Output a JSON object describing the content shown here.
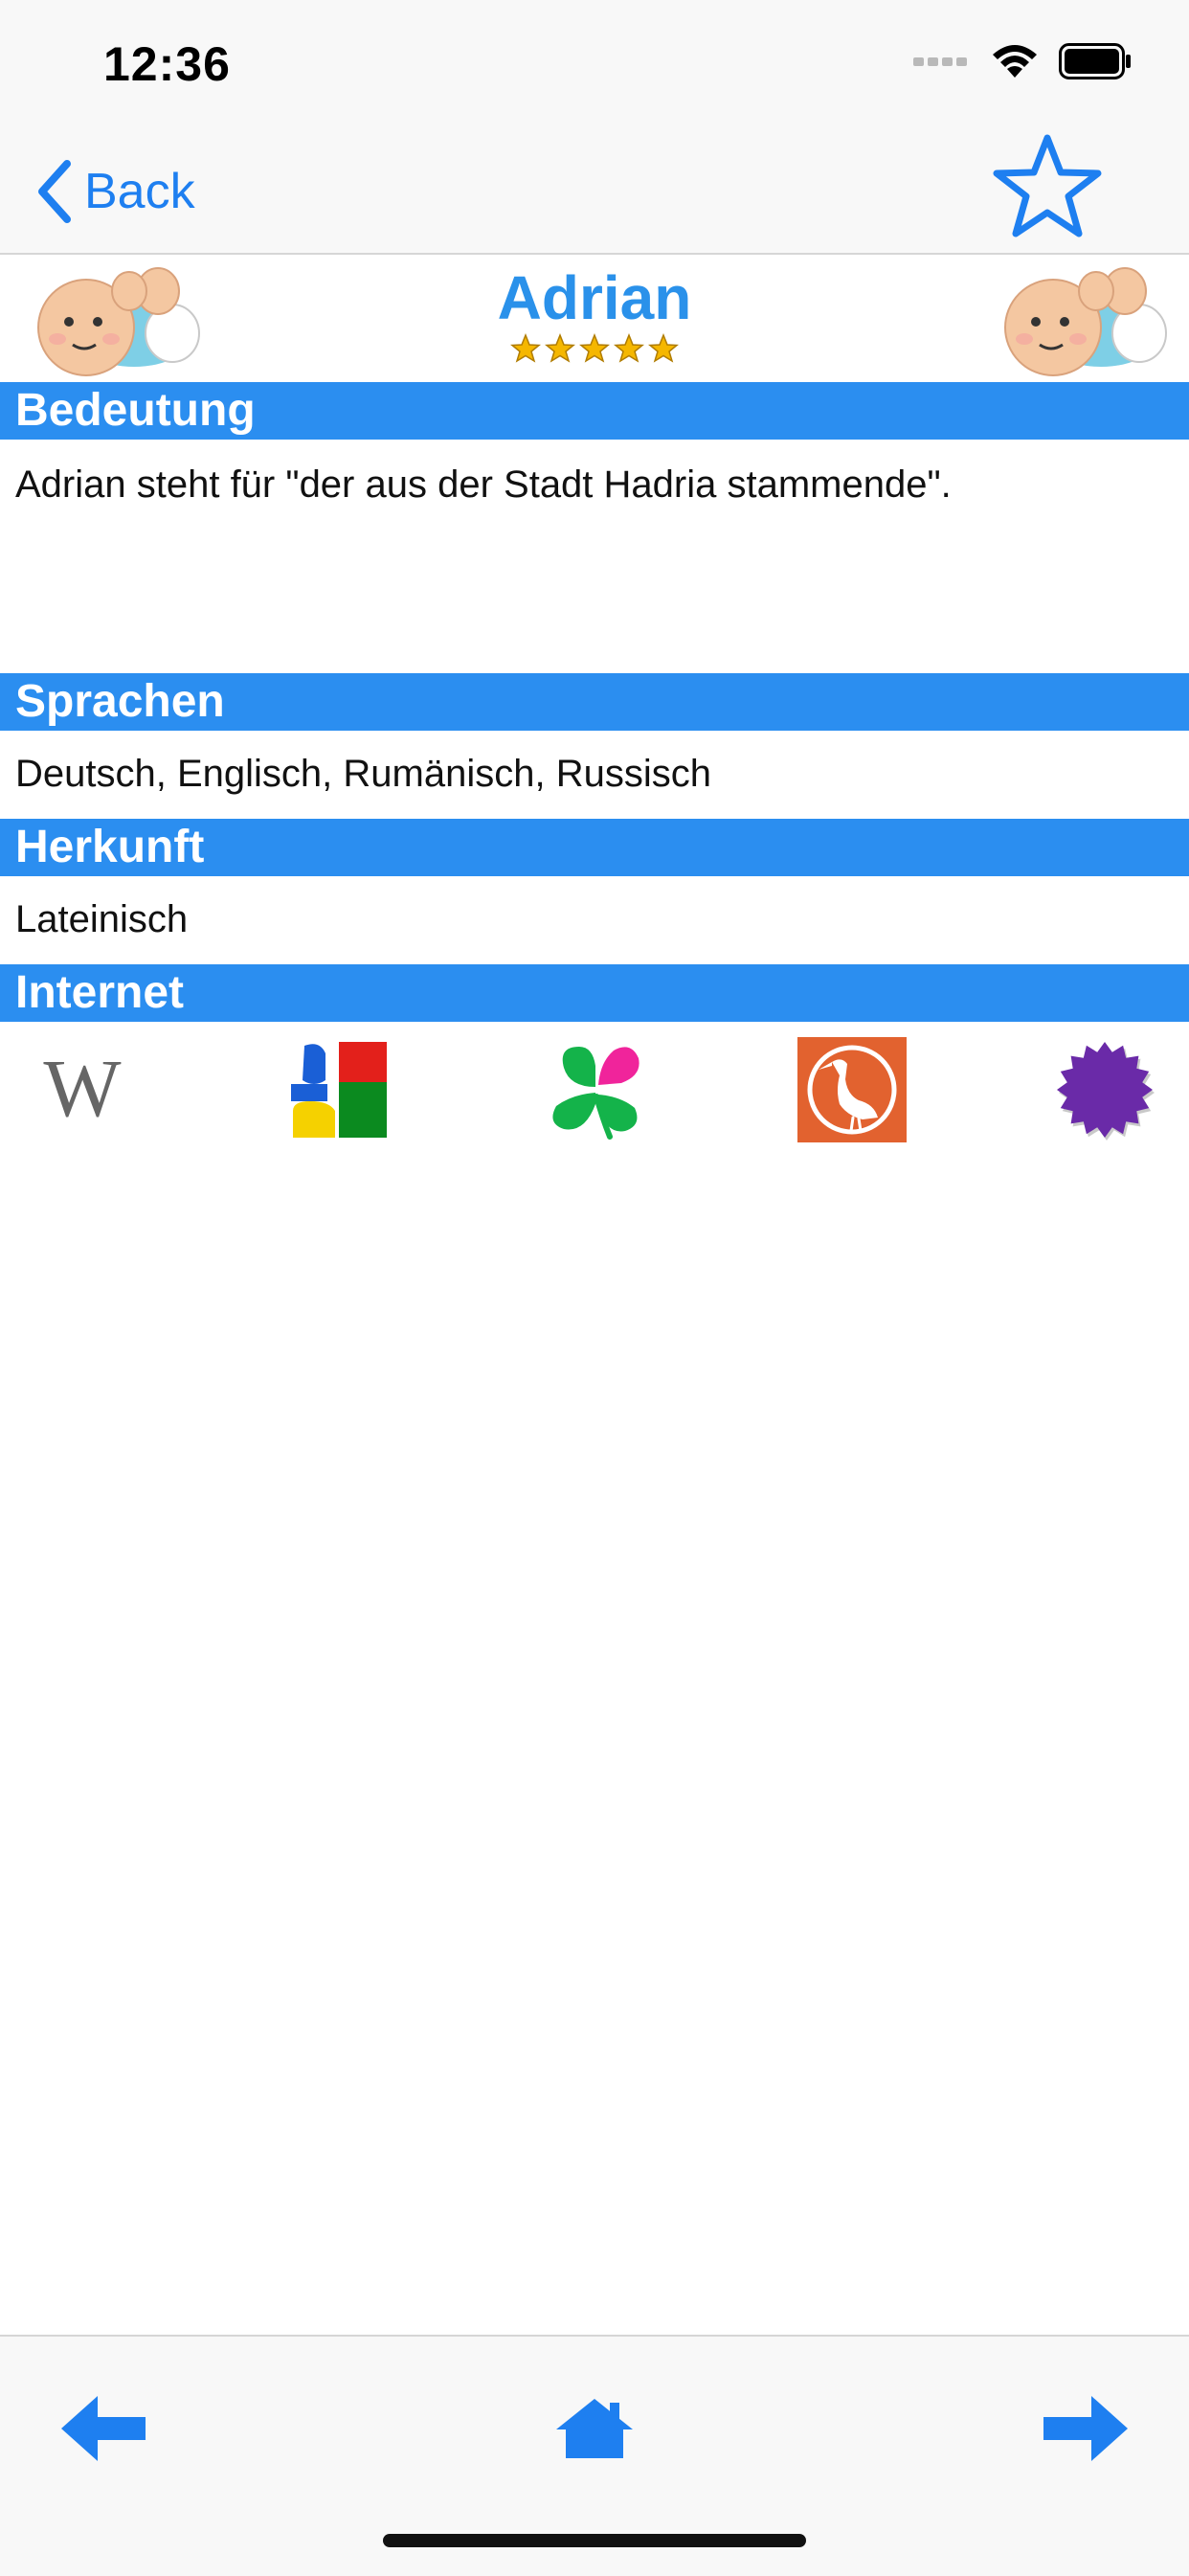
{
  "status_bar": {
    "time": "12:36"
  },
  "nav": {
    "back_label": "Back"
  },
  "name": {
    "title": "Adrian",
    "rating": 5,
    "rating_max": 5
  },
  "sections": {
    "meaning": {
      "header": "Bedeutung",
      "text": "Adrian steht für \"der aus der Stadt Hadria stammende\"."
    },
    "languages": {
      "header": "Sprachen",
      "text": "Deutsch, Englisch, Rumänisch, Russisch"
    },
    "origin": {
      "header": "Herkunft",
      "text": "Lateinisch"
    },
    "internet": {
      "header": "Internet"
    }
  },
  "links": [
    {
      "icon": "wikipedia-icon",
      "glyph": "W"
    },
    {
      "icon": "google-icon"
    },
    {
      "icon": "clover-icon"
    },
    {
      "icon": "stork-icon"
    },
    {
      "icon": "purple-seal-icon"
    }
  ],
  "colors": {
    "accent_blue": "#2b8ef0",
    "link_blue": "#1e7ff0",
    "title_blue": "#2a91ea",
    "star_gold": "#f5b700",
    "wiki_gray": "#666666",
    "google_blue": "#1a5fd6",
    "google_red": "#e3201b",
    "google_green": "#0b8a1f",
    "google_yellow": "#f5d100",
    "clover_green": "#14b34a",
    "clover_pink": "#f0249b",
    "stork_orange": "#e2622f",
    "seal_purple": "#6a2aa8"
  },
  "bottom_nav": {
    "prev_icon": "arrow-left-icon",
    "home_icon": "home-icon",
    "next_icon": "arrow-right-icon"
  }
}
